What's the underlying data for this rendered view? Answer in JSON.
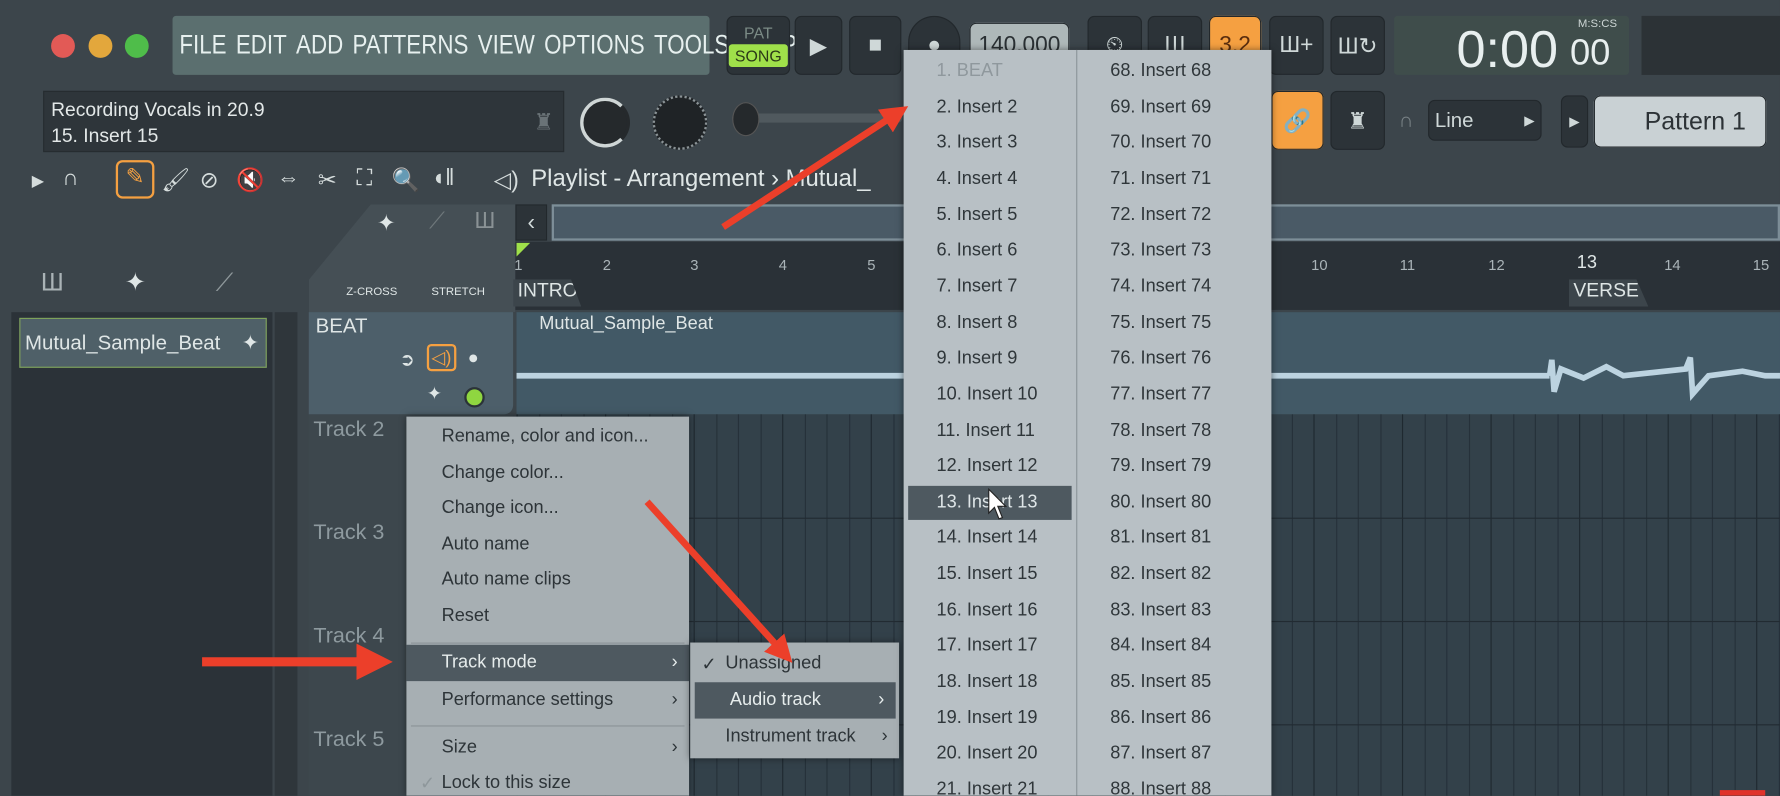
{
  "window": {
    "traffic_lights": [
      "#e25a56",
      "#e3a73c",
      "#4fbd4a"
    ]
  },
  "menu": [
    "FILE",
    "EDIT",
    "ADD",
    "PATTERNS",
    "VIEW",
    "OPTIONS",
    "TOOLS",
    "HELP"
  ],
  "transport": {
    "pat": "PAT",
    "song": "SONG",
    "tempo": "140.000",
    "time": "0:00",
    "time_cs": "00",
    "time_format": "M:S:CS",
    "snap_label": "3.2"
  },
  "hint": {
    "line1": "Recording Vocals in 20.9",
    "line2": "15. Insert 15"
  },
  "toolbar2": {
    "snap_mode": "Line",
    "pattern": "Pattern 1"
  },
  "playlist": {
    "title": "Playlist - Arrangement",
    "breadcrumb_sep": "›",
    "breadcrumb_item": "Mutual_",
    "zcross": "Z-CROSS",
    "stretch": "STRETCH"
  },
  "ruler": {
    "bars": [
      "1",
      "2",
      "3",
      "4",
      "5",
      "10",
      "11",
      "12",
      "13",
      "14",
      "15"
    ],
    "markers": [
      "INTRO",
      "VERSE"
    ]
  },
  "browser": {
    "item": "Mutual_Sample_Beat"
  },
  "tracks": [
    {
      "name": "BEAT",
      "clip": "Mutual_Sample_Beat"
    },
    {
      "name": "Track 2"
    },
    {
      "name": "Track 3"
    },
    {
      "name": "Track 4"
    },
    {
      "name": "Track 5"
    }
  ],
  "context_menu": {
    "items": [
      "Rename, color and icon...",
      "Change color...",
      "Change icon...",
      "Auto name",
      "Auto name clips",
      "Reset"
    ],
    "track_mode": "Track mode",
    "performance": "Performance settings",
    "size": "Size",
    "lock": "Lock to this size"
  },
  "track_mode_menu": {
    "unassigned": "Unassigned",
    "audio": "Audio track",
    "instrument": "Instrument track",
    "checked": "Unassigned",
    "highlighted": "Audio track"
  },
  "insert_menu": {
    "left": [
      "1. BEAT",
      "2. Insert 2",
      "3. Insert 3",
      "4. Insert 4",
      "5. Insert 5",
      "6. Insert 6",
      "7. Insert 7",
      "8. Insert 8",
      "9. Insert 9",
      "10. Insert 10",
      "11. Insert 11",
      "12. Insert 12",
      "13. Insert 13",
      "14. Insert 14",
      "15. Insert 15",
      "16. Insert 16",
      "17. Insert 17",
      "18. Insert 18",
      "19. Insert 19",
      "20. Insert 20",
      "21. Insert 21"
    ],
    "right": [
      "68. Insert 68",
      "69. Insert 69",
      "70. Insert 70",
      "71. Insert 71",
      "72. Insert 72",
      "73. Insert 73",
      "74. Insert 74",
      "75. Insert 75",
      "76. Insert 76",
      "77. Insert 77",
      "78. Insert 78",
      "79. Insert 79",
      "80. Insert 80",
      "81. Insert 81",
      "82. Insert 82",
      "83. Insert 83",
      "84. Insert 84",
      "85. Insert 85",
      "86. Insert 86",
      "87. Insert 87",
      "88. Insert 88"
    ],
    "disabled": "1. BEAT",
    "highlighted": "13. Insert 13"
  },
  "colors": {
    "accent_orange": "#f5a041",
    "annotation_red": "#ec3f2a",
    "song_green": "#9fe04a"
  }
}
